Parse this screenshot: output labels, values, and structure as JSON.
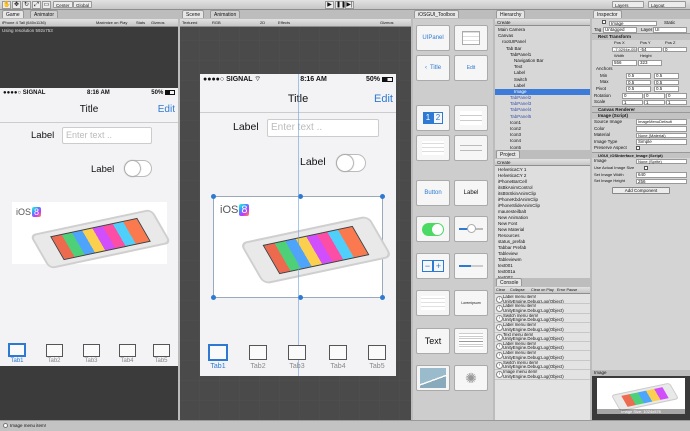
{
  "toolbar": {
    "center_label": "Center",
    "global_label": "Global",
    "play_icon": "play-icon",
    "pause_icon": "pause-icon",
    "step_icon": "step-icon",
    "layers_label": "Layers",
    "layout_label": "Layout"
  },
  "game_view": {
    "tab_game": "Game",
    "tab_animator": "Animator",
    "aspect": "iPhone 4 Tall (640x1136)",
    "maximize": "Maximize on Play",
    "stats": "Stats",
    "gizmos": "Gizmos",
    "resolution_note": "Using resolution 592x753"
  },
  "scene_view": {
    "tab_scene": "Scene",
    "tab_animation": "Animation",
    "shading": "Textured",
    "rgb": "RGB",
    "mode_2d": "2D",
    "effects": "Effects",
    "gizmos": "Gizmos"
  },
  "phone": {
    "carrier": "SIGNAL",
    "time": "8:16 AM",
    "battery": "50%",
    "nav_title": "Title",
    "nav_edit": "Edit",
    "label1": "Label",
    "input_placeholder": "Enter text ..",
    "label2": "Label",
    "ios_logo": "iOS",
    "ios_version": "8",
    "tabs": [
      "Tab1",
      "Tab2",
      "Tab3",
      "Tab4",
      "Tab5"
    ]
  },
  "toolbox": {
    "title": "iOSGUI_Toolbox",
    "uipanel": "UIPanel",
    "title_item": "Title",
    "seg_1": "1",
    "seg_2": "2",
    "button": "Button",
    "label": "Label",
    "text": "Text",
    "lorem": "Loremipsum",
    "edit": "Edit"
  },
  "hierarchy": {
    "title": "Hierarchy",
    "create": "Create",
    "items": [
      {
        "name": "Main Camera",
        "indent": 0
      },
      {
        "name": "Canvas",
        "indent": 0
      },
      {
        "name": "rootUIPanel",
        "indent": 1
      },
      {
        "name": "Tab Bar",
        "indent": 2
      },
      {
        "name": "TabPanel1",
        "indent": 3
      },
      {
        "name": "Navigation Bar",
        "indent": 4
      },
      {
        "name": "Text",
        "indent": 4
      },
      {
        "name": "Label",
        "indent": 4
      },
      {
        "name": "Switch",
        "indent": 4
      },
      {
        "name": "Label",
        "indent": 4
      },
      {
        "name": "Image",
        "indent": 4,
        "selected": true
      },
      {
        "name": "TabPanel2",
        "indent": 3,
        "dim": true
      },
      {
        "name": "TabPanel3",
        "indent": 3,
        "dim": true
      },
      {
        "name": "TabPanel4",
        "indent": 3,
        "dim": true
      },
      {
        "name": "TabPanel5",
        "indent": 3,
        "dim": true
      },
      {
        "name": "Icon1",
        "indent": 3
      },
      {
        "name": "Icon2",
        "indent": 3
      },
      {
        "name": "Icon3",
        "indent": 3
      },
      {
        "name": "Icon4",
        "indent": 3
      },
      {
        "name": "Icon5",
        "indent": 3
      },
      {
        "name": "EventSystem",
        "indent": 0
      }
    ]
  },
  "project": {
    "title": "Project",
    "create": "Create",
    "items": [
      "HelveticaCY 1",
      "HelveticaCY 2",
      "iPhoneBarCell",
      "itsBkAnimControl",
      "itsBtnSkinAnimClip",
      "iPhoneKbdAnimClip",
      "iPhoneSlideAnimClip",
      "mauresteilbalt",
      "New Animation",
      "New Font",
      "New Material",
      "Resources",
      "status_prefab",
      "Tabbar Prefab",
      "Tableview",
      "Tableviewm",
      "text001",
      "text001a",
      "text002",
      "text003"
    ]
  },
  "console": {
    "title": "Console",
    "clear": "Clear",
    "collapse": "Collapse",
    "clear_on_play": "Clear on Play",
    "error_pause": "Error Pause",
    "entries": [
      {
        "l1": "Label menu item!",
        "l2": "UnityEngine.Debug:Log(Object)"
      },
      {
        "l1": "Label menu item!",
        "l2": "UnityEngine.Debug:Log(Object)"
      },
      {
        "l1": "Switch menu item!",
        "l2": "UnityEngine.Debug:Log(Object)"
      },
      {
        "l1": "Label menu item!",
        "l2": "UnityEngine.Debug:Log(Object)"
      },
      {
        "l1": "Text menu item!",
        "l2": "UnityEngine.Debug:Log(Object)"
      },
      {
        "l1": "Label menu item!",
        "l2": "UnityEngine.Debug:Log(Object)"
      },
      {
        "l1": "Label menu item!",
        "l2": "UnityEngine.Debug:Log(Object)"
      },
      {
        "l1": "Switch menu item!",
        "l2": "UnityEngine.Debug:Log(Object)"
      },
      {
        "l1": "Image menu item!",
        "l2": "UnityEngine.Debug:Log(Object)"
      }
    ]
  },
  "inspector": {
    "title": "Inspector",
    "object_name": "Image",
    "static": "Static",
    "tag_label": "Tag",
    "tag_value": "Untagged",
    "layer_label": "Layer",
    "layer_value": "UI",
    "rect_transform": "Rect Transform",
    "pos_x_label": "Pos X",
    "pos_y_label": "Pos Y",
    "pos_z_label": "Pos Z",
    "pos_x": "-7.0294e-05",
    "pos_y": "-54",
    "pos_z": "0",
    "width_label": "Width",
    "height_label": "Height",
    "width": "556",
    "height": "323",
    "anchors": "Anchors",
    "min_label": "Min",
    "max_label": "Max",
    "pivot_label": "Pivot",
    "min_x": "0.5",
    "min_y": "0.5",
    "max_x": "0.5",
    "max_y": "0.5",
    "pivot_x": "0.5",
    "pivot_y": "0.5",
    "rotation_label": "Rotation",
    "scale_label": "Scale",
    "rot_x": "0",
    "rot_y": "0",
    "rot_z": "0",
    "scale_x": "1",
    "scale_y": "1",
    "scale_z": "1",
    "canvas_renderer": "Canvas Renderer",
    "image_script": "Image (Script)",
    "source_image_label": "Source Image",
    "source_image": "ImageMenuDefault",
    "color_label": "Color",
    "material_label": "Material",
    "material": "None (Material)",
    "image_type_label": "Image Type",
    "image_type": "Simple",
    "preserve_aspect": "Preserve Aspect",
    "ugui_script": "UGUI_iOSInterface_Image (Script)",
    "image_label": "Image",
    "image_value": "None (Sprite)",
    "use_actual_label": "Use Actual Image Size",
    "set_width_label": "Set Image Width",
    "set_width": "640",
    "set_height_label": "Set Image Height",
    "set_height": "256",
    "add_component": "Add Component",
    "preview_title": "Image",
    "preview_caption": "Image Size: 1024x576"
  },
  "status_bar": {
    "text": "Image menu item!"
  },
  "colors": {
    "ios_blue": "#2e7ad2",
    "selection_blue": "#3d7bd9",
    "toggle_green": "#4cd964"
  }
}
